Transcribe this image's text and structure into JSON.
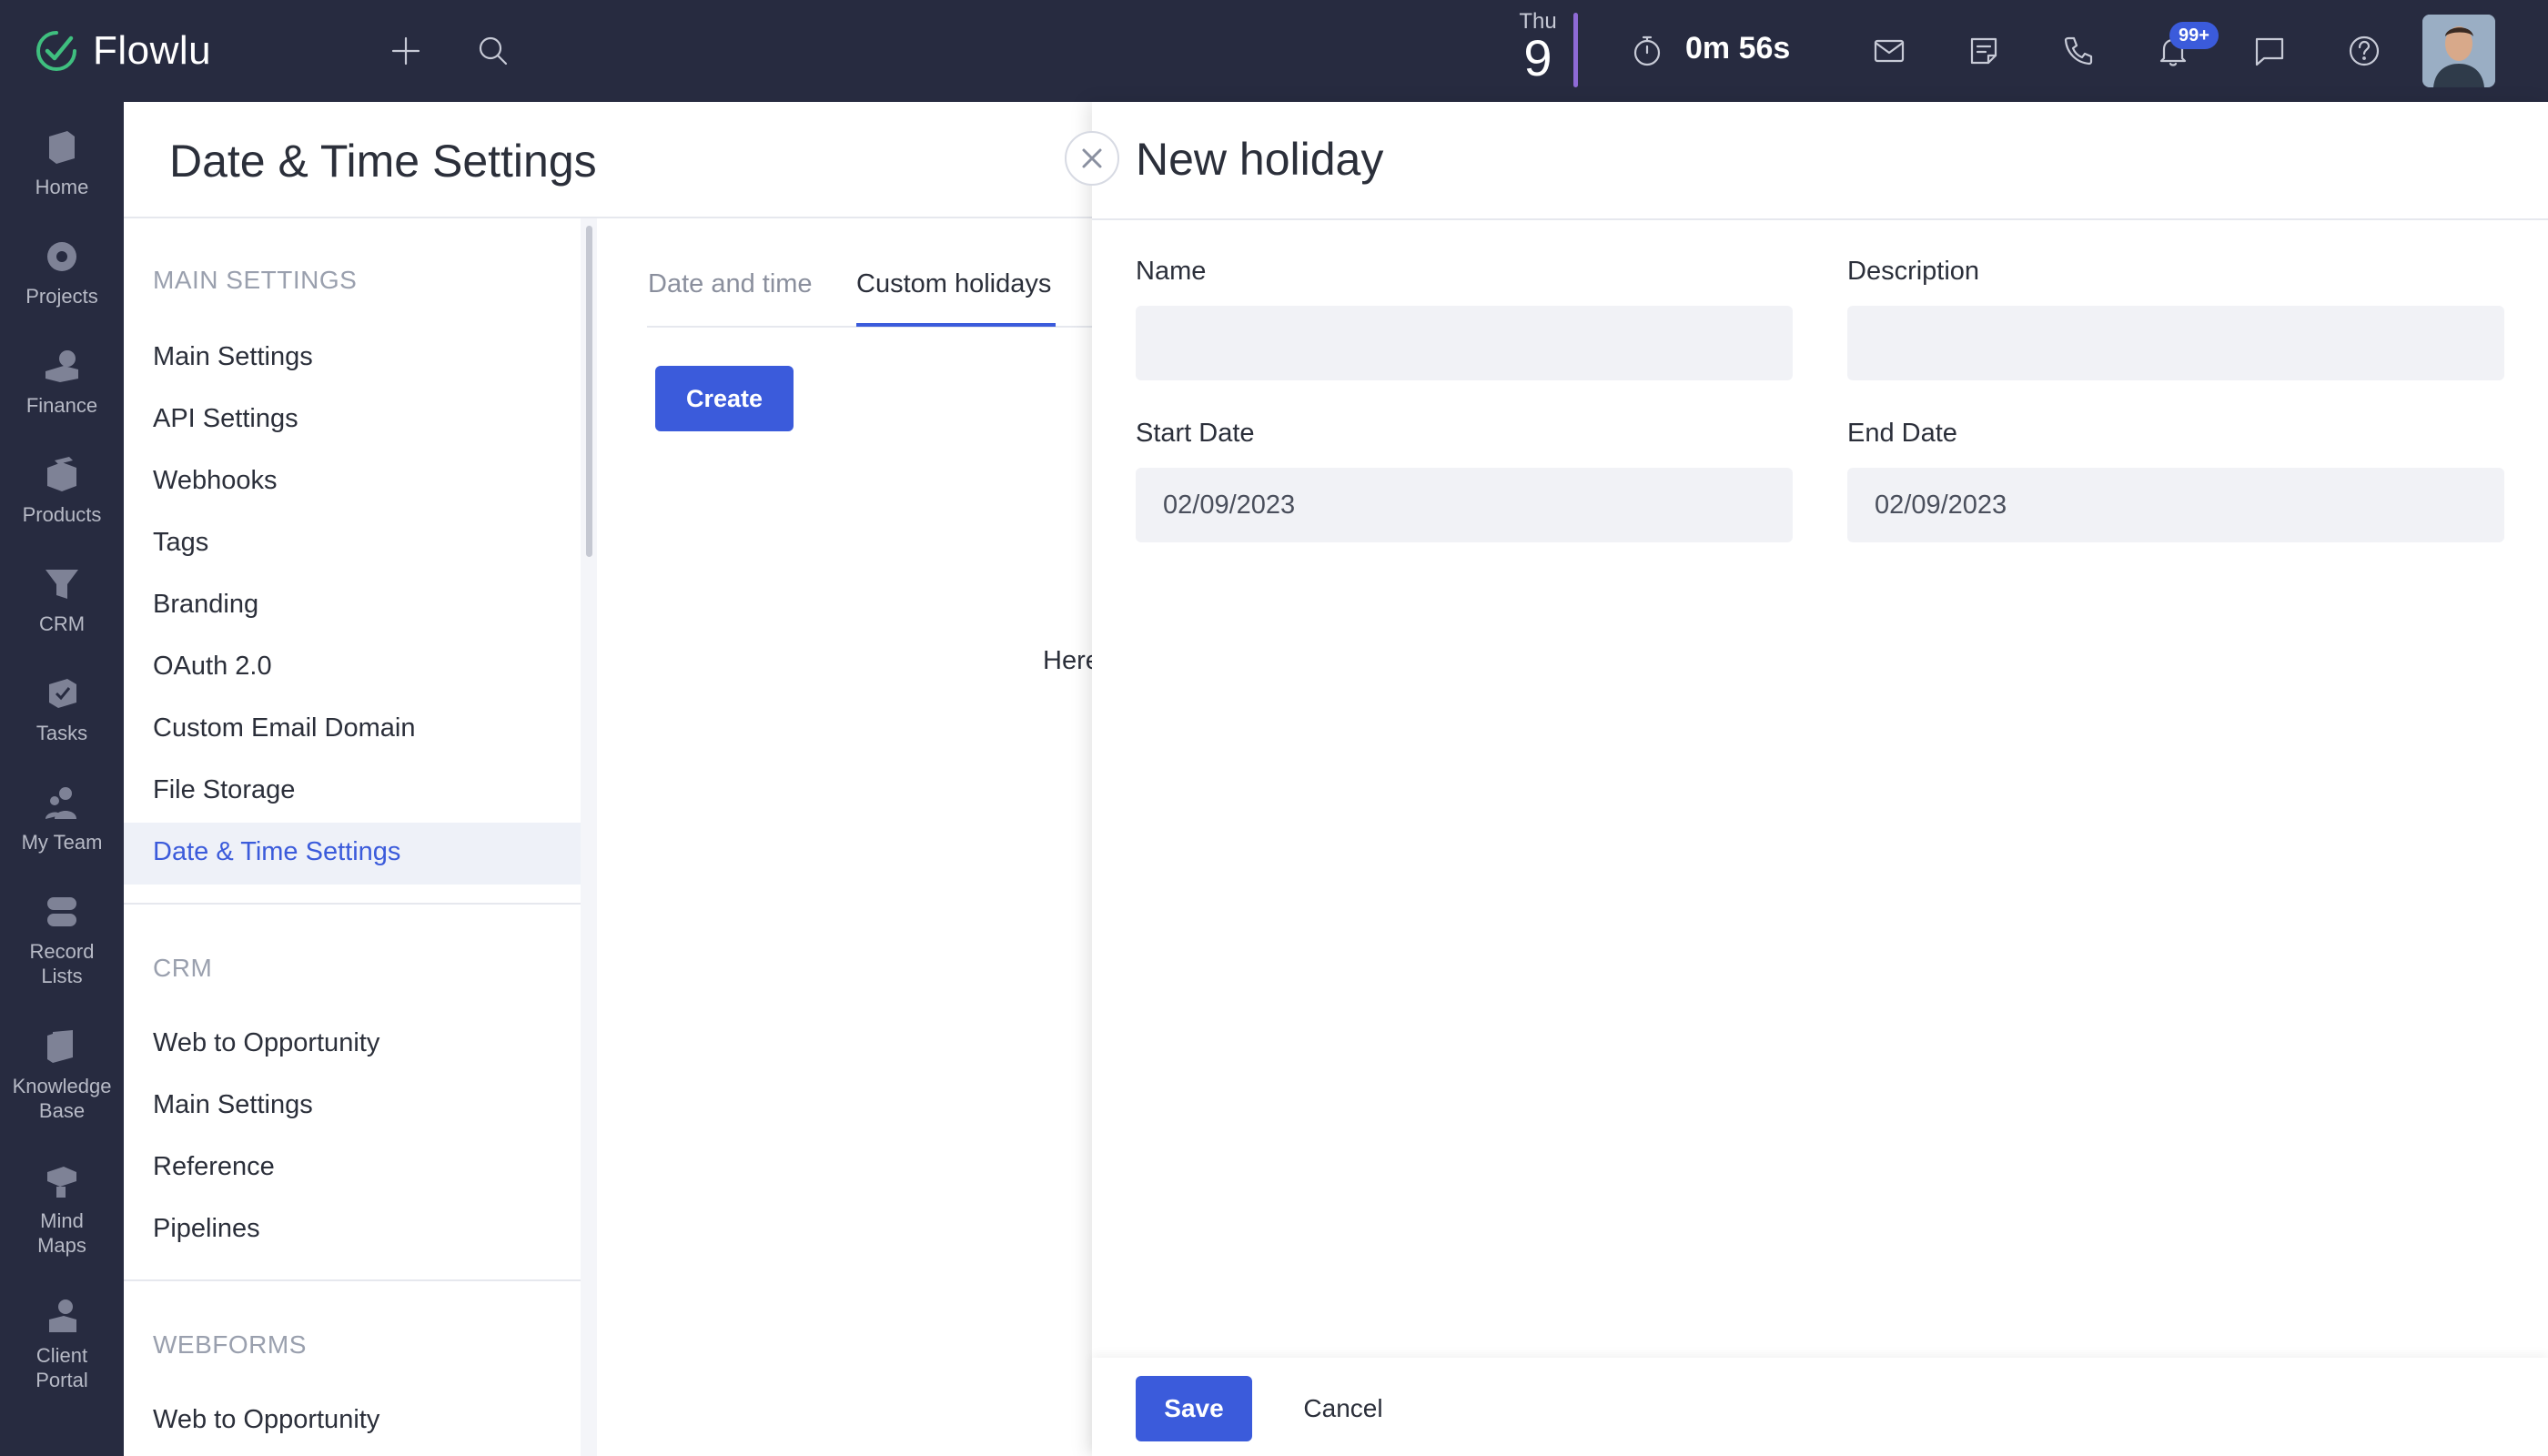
{
  "app": {
    "name": "Flowlu",
    "brand_color": "#3b5bdb",
    "topbar_bg": "#272b40"
  },
  "topbar": {
    "date_weekday": "Thu",
    "date_day": "9",
    "timer": "0m 56s",
    "notifications_badge": "99+",
    "icons": [
      "plus-icon",
      "search-icon",
      "stopwatch-icon",
      "mail-icon",
      "notes-icon",
      "phone-icon",
      "bell-icon",
      "chat-icon",
      "help-icon"
    ]
  },
  "sidebar": {
    "items": [
      {
        "label": "Home",
        "icon": "home-icon"
      },
      {
        "label": "Projects",
        "icon": "projects-icon"
      },
      {
        "label": "Finance",
        "icon": "finance-icon"
      },
      {
        "label": "Products",
        "icon": "products-icon"
      },
      {
        "label": "CRM",
        "icon": "crm-icon"
      },
      {
        "label": "Tasks",
        "icon": "tasks-icon"
      },
      {
        "label": "My Team",
        "icon": "team-icon"
      },
      {
        "label": "Record\nLists",
        "icon": "record-lists-icon"
      },
      {
        "label": "Knowledge\nBase",
        "icon": "knowledge-base-icon"
      },
      {
        "label": "Mind\nMaps",
        "icon": "mind-maps-icon"
      },
      {
        "label": "Client\nPortal",
        "icon": "client-portal-icon"
      }
    ]
  },
  "settings": {
    "title": "Date & Time Settings",
    "sections": [
      {
        "heading": "MAIN SETTINGS",
        "links": [
          "Main Settings",
          "API Settings",
          "Webhooks",
          "Tags",
          "Branding",
          "OAuth 2.0",
          "Custom Email Domain",
          "File Storage",
          "Date & Time Settings"
        ]
      },
      {
        "heading": "CRM",
        "links": [
          "Web to Opportunity",
          "Main Settings",
          "Reference",
          "Pipelines"
        ]
      },
      {
        "heading": "WEBFORMS",
        "links": [
          "Web to Opportunity"
        ]
      }
    ],
    "active_link": "Date & Time Settings",
    "tabs": [
      "Date and time",
      "Custom holidays"
    ],
    "active_tab": "Custom holidays",
    "create_button": "Create",
    "empty_text_partial": "Here"
  },
  "panel": {
    "title": "New holiday",
    "fields": {
      "name_label": "Name",
      "name_value": "",
      "description_label": "Description",
      "description_value": "",
      "start_date_label": "Start Date",
      "start_date_value": "02/09/2023",
      "end_date_label": "End Date",
      "end_date_value": "02/09/2023"
    },
    "save_button": "Save",
    "cancel_button": "Cancel"
  }
}
